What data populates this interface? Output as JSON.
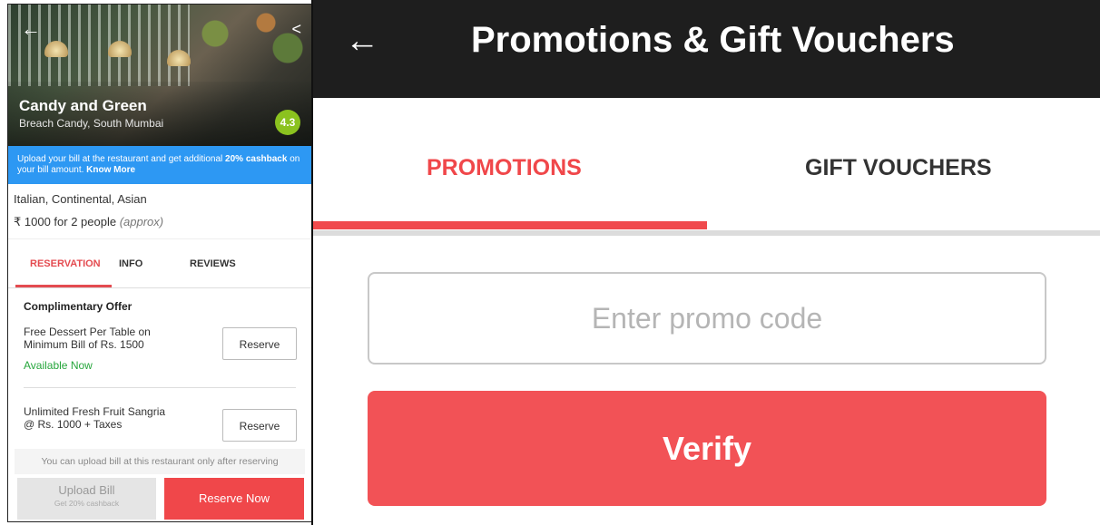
{
  "left_panel": {
    "hero": {
      "restaurant_name": "Candy and Green",
      "location": "Breach Candy, South Mumbai",
      "rating": "4.3",
      "back_icon": "←",
      "share_icon": "<"
    },
    "cashback_banner": {
      "text_start": "Upload your bill at the restaurant and get additional ",
      "bold_percent": "20% cashback",
      "text_mid": " on your bill amount. ",
      "know_more": "Know More"
    },
    "cuisine": "Italian, Continental, Asian",
    "cost": "₹ 1000 for 2 people",
    "cost_note": "(approx)",
    "tabs": [
      "RESERVATION",
      "INFO",
      "REVIEWS"
    ],
    "offers_heading": "Complimentary Offer",
    "offers": [
      {
        "text": "Free Dessert Per Table on Minimum Bill of Rs. 1500",
        "status": "Available Now",
        "button": "Reserve"
      },
      {
        "text": "Unlimited Fresh Fruit Sangria @ Rs. 1000 + Taxes",
        "button": "Reserve"
      }
    ],
    "upload_note": "You can upload bill at this restaurant only after reserving",
    "upload_button": {
      "label": "Upload Bill",
      "sub": "Get 20% cashback"
    },
    "reserve_now": "Reserve Now"
  },
  "right_panel": {
    "back_icon": "←",
    "title": "Promotions & Gift Vouchers",
    "tabs": [
      "PROMOTIONS",
      "GIFT VOUCHERS"
    ],
    "promo_input": {
      "placeholder": "Enter promo code",
      "value": ""
    },
    "verify_button": "Verify"
  },
  "colors": {
    "accent_red": "#f0474a",
    "rating_green": "#8bc21f",
    "banner_blue": "#2d98f3",
    "available_green": "#26a63c",
    "topbar": "#1e1e1e"
  }
}
